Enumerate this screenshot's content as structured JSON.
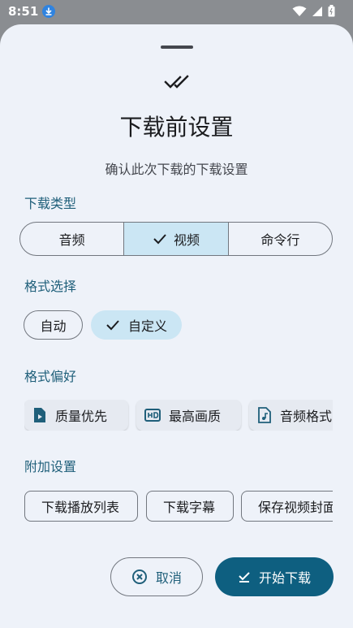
{
  "status_bar": {
    "time": "8:51"
  },
  "sheet": {
    "title": "下载前设置",
    "subtitle": "确认此次下载的下载设置",
    "download_type": {
      "label": "下载类型",
      "options": [
        "音频",
        "视频",
        "命令行"
      ],
      "selected": "视频"
    },
    "format_select": {
      "label": "格式选择",
      "options": [
        "自动",
        "自定义"
      ],
      "selected": "自定义"
    },
    "format_pref": {
      "label": "格式偏好",
      "items": [
        "质量优先",
        "最高画质",
        "音频格式"
      ]
    },
    "extra_settings": {
      "label": "附加设置",
      "items": [
        "下载播放列表",
        "下载字幕",
        "保存视频封面"
      ]
    },
    "actions": {
      "cancel": "取消",
      "start": "开始下载"
    }
  },
  "colors": {
    "primary": "#0e5f80",
    "selected_bg": "#cbe6f4",
    "sheet_bg": "#eef2f9",
    "label": "#1f5f7a"
  }
}
